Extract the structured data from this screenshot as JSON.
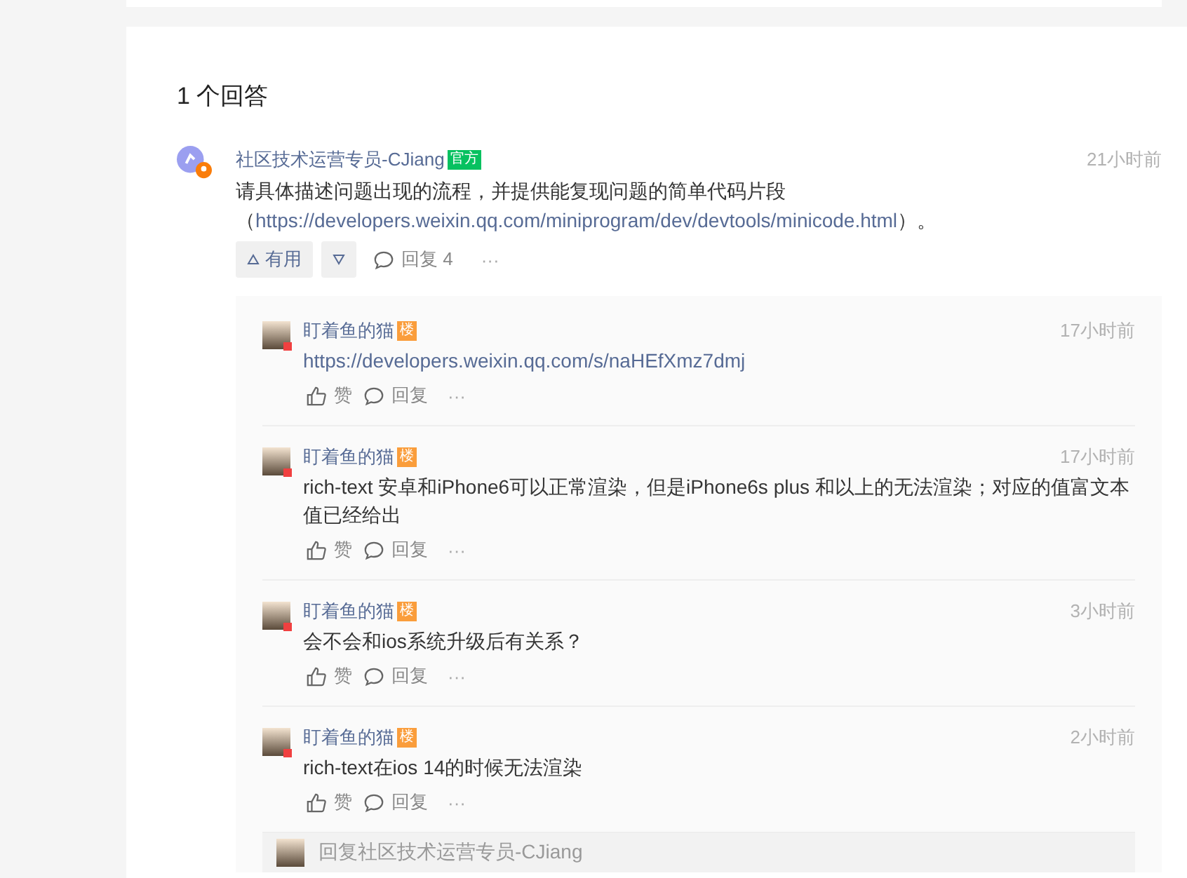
{
  "answers_heading": "1 个回答",
  "answer": {
    "author": "社区技术运营专员-CJiang",
    "badge": "官方",
    "time": "21小时前",
    "content": [
      {
        "kind": "text",
        "text": "请具体描述问题出现的流程，并提供能复现问题的简单代码片段（"
      },
      {
        "kind": "link",
        "text": "https://developers.weixin.qq.com/miniprogram/dev/devtools/minicode.html"
      },
      {
        "kind": "text",
        "text": "）。"
      }
    ],
    "useful_label": "有用",
    "reply_label": "回复 4",
    "more_label": "···"
  },
  "replies": [
    {
      "author": "盯着鱼的猫",
      "badge": "楼",
      "time": "17小时前",
      "content": [
        {
          "kind": "link",
          "text": "https://developers.weixin.qq.com/s/naHEfXmz7dmj"
        }
      ],
      "like_label": "赞",
      "reply_label": "回复",
      "more_label": "···"
    },
    {
      "author": "盯着鱼的猫",
      "badge": "楼",
      "time": "17小时前",
      "content": [
        {
          "kind": "text",
          "text": "rich-text 安卓和iPhone6可以正常渲染，但是iPhone6s plus 和以上的无法渲染；对应的值富文本值已经给出"
        }
      ],
      "like_label": "赞",
      "reply_label": "回复",
      "more_label": "···"
    },
    {
      "author": "盯着鱼的猫",
      "badge": "楼",
      "time": "3小时前",
      "content": [
        {
          "kind": "text",
          "text": "会不会和ios系统升级后有关系？"
        }
      ],
      "like_label": "赞",
      "reply_label": "回复",
      "more_label": "···"
    },
    {
      "author": "盯着鱼的猫",
      "badge": "楼",
      "time": "2小时前",
      "content": [
        {
          "kind": "text",
          "text": "rich-text在ios 14的时候无法渲染"
        }
      ],
      "like_label": "赞",
      "reply_label": "回复",
      "more_label": "···"
    }
  ],
  "reply_box": {
    "placeholder": "回复社区技术运营专员-CJiang"
  }
}
